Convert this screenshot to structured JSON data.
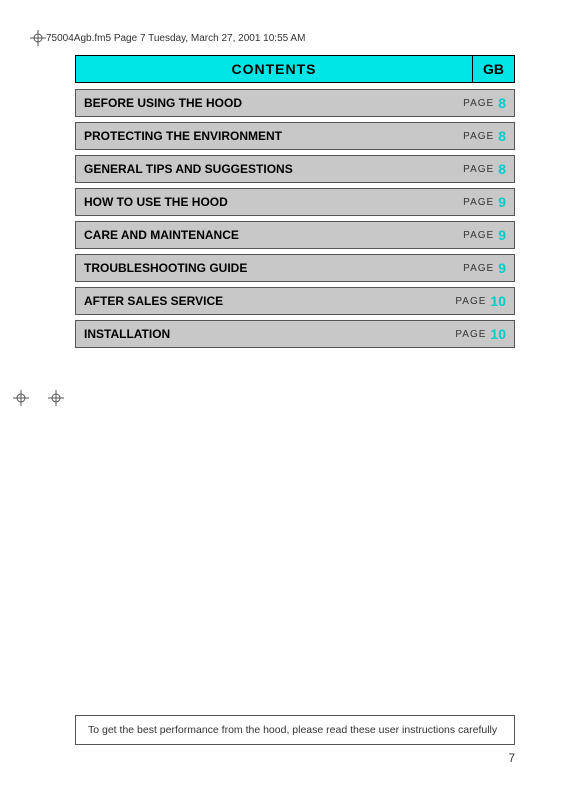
{
  "header": {
    "file_info": "75004Agb.fm5  Page 7  Tuesday, March 27, 2001  10:55 AM"
  },
  "contents": {
    "title": "CONTENTS",
    "gb_label": "GB",
    "rows": [
      {
        "label": "BEFORE USING THE HOOD",
        "page_label": "PAGE",
        "page_num": "8"
      },
      {
        "label": "PROTECTING THE ENVIRONMENT",
        "page_label": "PAGE",
        "page_num": "8"
      },
      {
        "label": "GENERAL TIPS AND SUGGESTIONS",
        "page_label": "PAGE",
        "page_num": "8"
      },
      {
        "label": "HOW TO USE THE HOOD",
        "page_label": "PAGE",
        "page_num": "9"
      },
      {
        "label": "CARE AND MAINTENANCE",
        "page_label": "PAGE",
        "page_num": "9"
      },
      {
        "label": "TROUBLESHOOTING GUIDE",
        "page_label": "PAGE",
        "page_num": "9"
      },
      {
        "label": "AFTER SALES SERVICE",
        "page_label": "PAGE",
        "page_num": "10"
      },
      {
        "label": "INSTALLATION",
        "page_label": "PAGE",
        "page_num": "10"
      }
    ]
  },
  "notice": {
    "text": "To get the best performance from the hood, please read these user instructions carefully"
  },
  "page_number": "7"
}
